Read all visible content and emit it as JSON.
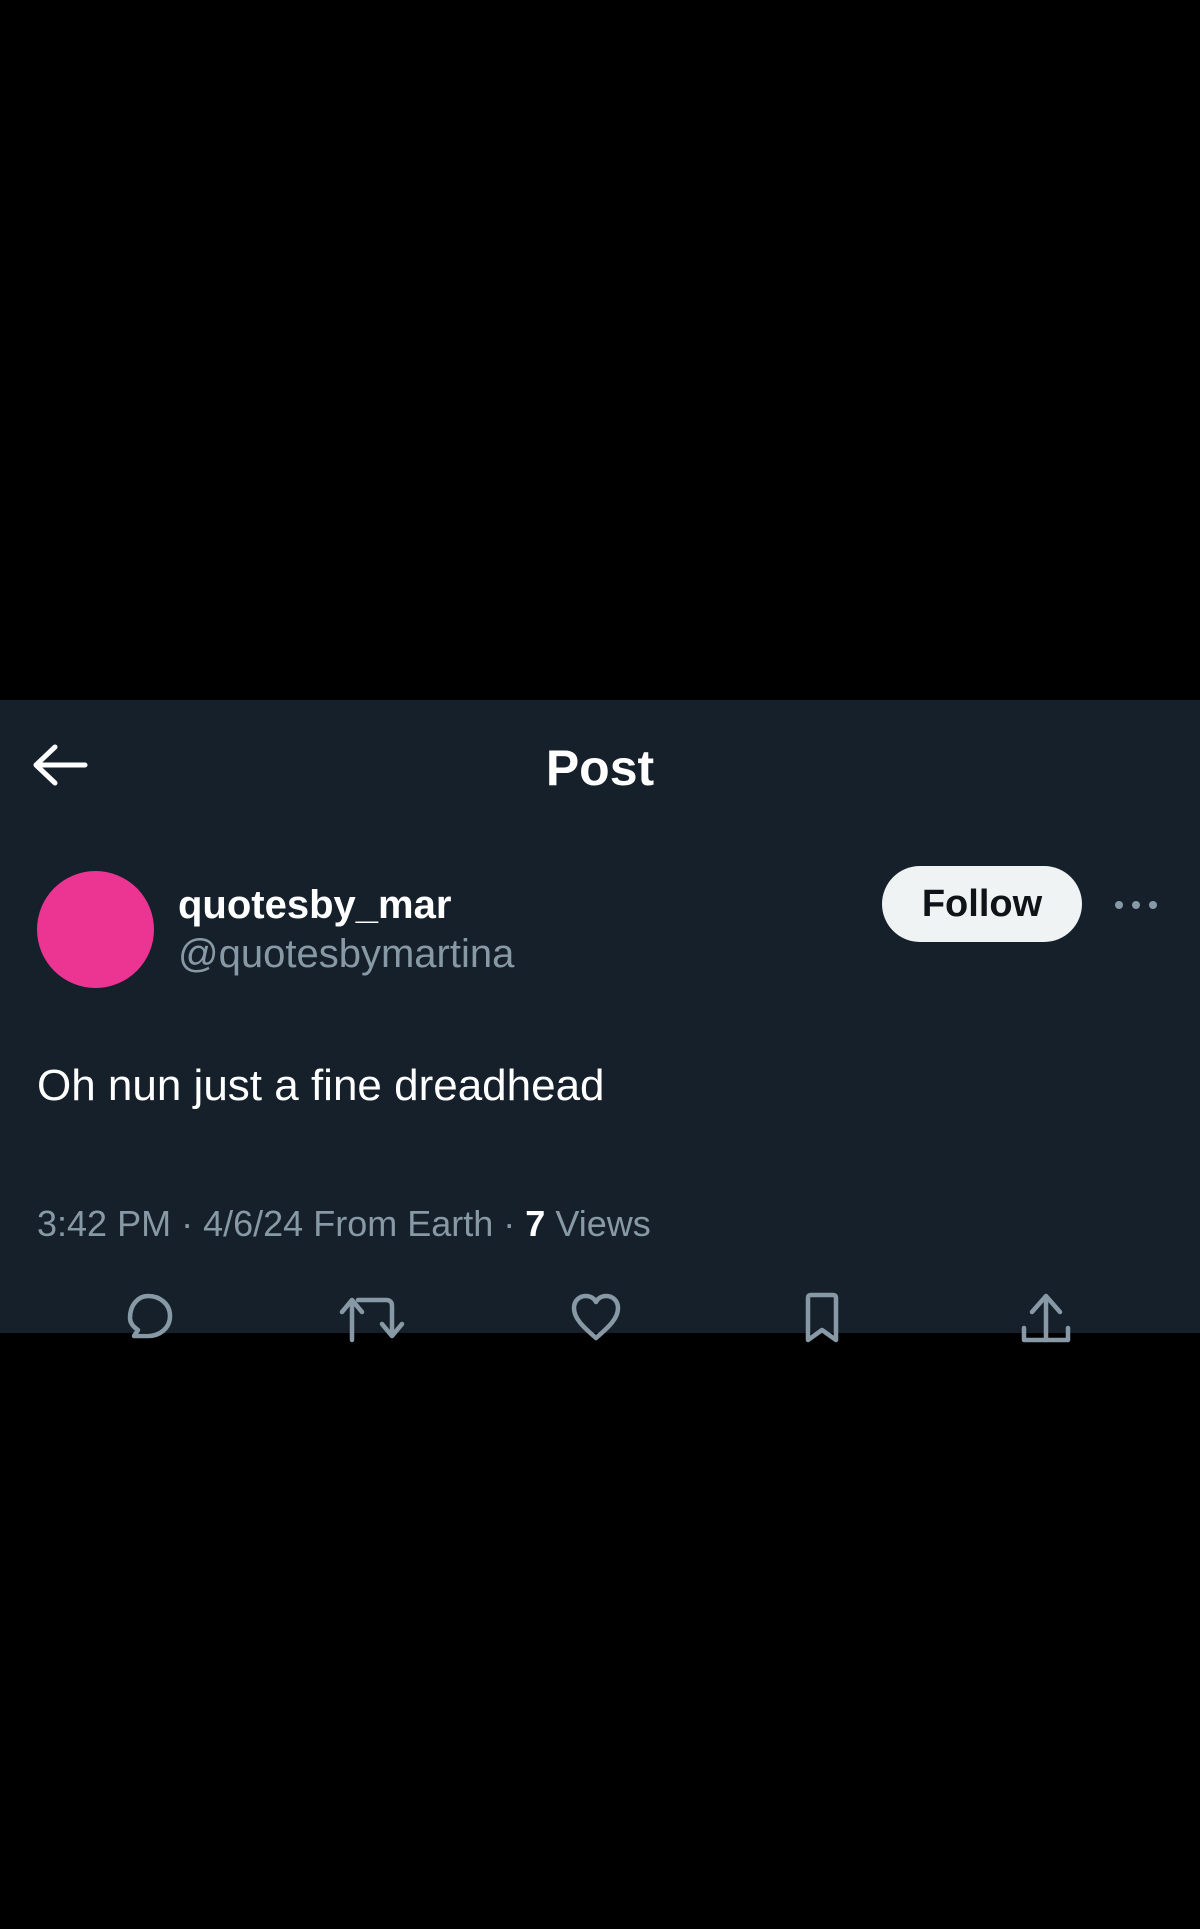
{
  "header": {
    "title": "Post",
    "back_icon": "arrow-left-icon"
  },
  "post": {
    "author": {
      "display_name": "quotesby_mar",
      "handle": "@quotesbymartina",
      "avatar_color": "#ec3493"
    },
    "follow_label": "Follow",
    "more_icon": "more-horizontal-icon",
    "text": "Oh nun just a fine dreadhead",
    "time": "3:42 PM",
    "date": "4/6/24",
    "location": "From Earth",
    "views_count": "7",
    "views_label": "Views",
    "separator": "·"
  },
  "actions": [
    {
      "name": "reply",
      "icon": "reply-icon"
    },
    {
      "name": "repost",
      "icon": "repost-icon"
    },
    {
      "name": "like",
      "icon": "heart-icon"
    },
    {
      "name": "bookmark",
      "icon": "bookmark-icon"
    },
    {
      "name": "share",
      "icon": "share-icon"
    }
  ],
  "colors": {
    "background": "#15202b",
    "letterbox": "#000000",
    "primary_text": "#ffffff",
    "secondary_text": "#8899a6",
    "follow_button_bg": "#eff3f4",
    "follow_button_text": "#0f1419"
  }
}
